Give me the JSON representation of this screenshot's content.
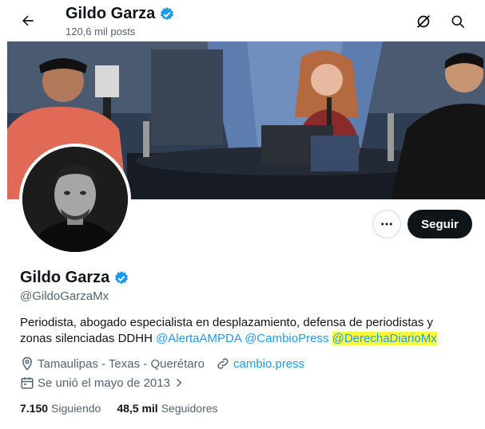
{
  "topbar": {
    "name": "Gildo Garza",
    "posts": "120,6 mil posts"
  },
  "profile": {
    "name": "Gildo Garza",
    "handle": "@GildoGarzaMx",
    "bio_text": "Periodista, abogado especialista en desplazamiento, defensa de periodistas y zonas silenciadas DDHH",
    "bio_mentions": [
      "@AlertaAMPDA",
      "@CambioPress",
      "@DerechaDiarioMx"
    ],
    "location": "Tamaulipas - Texas - Querétaro",
    "website": "cambio.press",
    "joined": "Se unió el mayo de 2013"
  },
  "actions": {
    "follow_label": "Seguir"
  },
  "stats": {
    "following_count": "7.150",
    "following_label": "Siguiendo",
    "followers_count": "48,5 mil",
    "followers_label": "Seguidores"
  },
  "colors": {
    "accent": "#1d9bf0",
    "verified": "#1d9bf0",
    "highlight": "#ffff3b",
    "text": "#0f1419",
    "muted": "#536471"
  },
  "icons": [
    "back-arrow-icon",
    "verified-badge-icon",
    "grok-icon",
    "search-icon",
    "more-icon",
    "location-icon",
    "link-icon",
    "calendar-icon",
    "chevron-right-icon"
  ]
}
